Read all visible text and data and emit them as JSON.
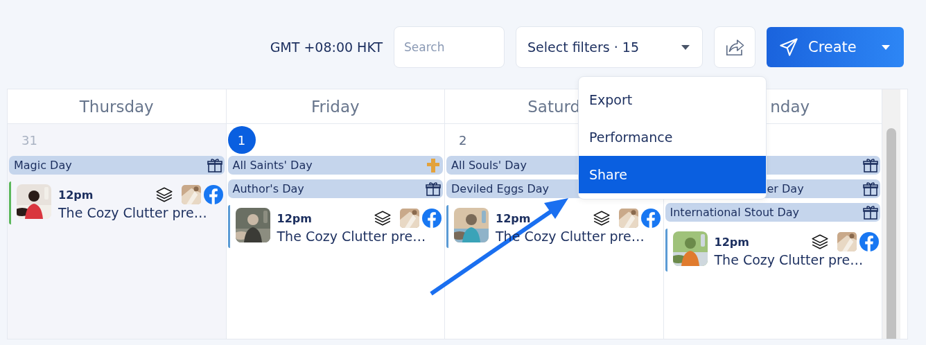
{
  "toolbar": {
    "timezone": "GMT +08:00 HKT",
    "search": {
      "placeholder": "Search"
    },
    "filters": "Select filters · 15",
    "create": "Create"
  },
  "menu": [
    {
      "label": "Export",
      "selected": false
    },
    {
      "label": "Performance",
      "selected": false
    },
    {
      "label": "Share",
      "selected": true
    }
  ],
  "days": [
    {
      "name": "Thursday",
      "date": "31",
      "today": false,
      "past": true,
      "events": [
        {
          "label": "Magic Day",
          "kind": "gift"
        }
      ],
      "posts": [
        {
          "time": "12pm",
          "title": "The Cozy Clutter pre…",
          "color": "#5cb85c"
        }
      ]
    },
    {
      "name": "Friday",
      "date": "1",
      "today": true,
      "past": false,
      "events": [
        {
          "label": "All Saints' Day",
          "kind": "cross"
        },
        {
          "label": "Author's Day",
          "kind": "gift"
        }
      ],
      "posts": [
        {
          "time": "12pm",
          "title": "The Cozy Clutter pre…",
          "color": "#5b9bd5"
        }
      ]
    },
    {
      "name": "Saturd",
      "date": "2",
      "today": false,
      "past": false,
      "events": [
        {
          "label": "All Souls' Day"
        },
        {
          "label": "Deviled Eggs Day"
        }
      ],
      "posts": [
        {
          "time": "12pm",
          "title": "The Cozy Clutter pre…",
          "color": "#5b9bd5"
        }
      ]
    },
    {
      "name": "nday",
      "events": [
        {
          "kind": "gift"
        },
        {
          "label": "er Day",
          "kind": "gift"
        },
        {
          "label": "International Stout Day",
          "kind": "gift"
        }
      ],
      "posts": [
        {
          "time": "12pm",
          "title": "The Cozy Clutter pre…",
          "color": "#5b9bd5"
        }
      ]
    }
  ]
}
